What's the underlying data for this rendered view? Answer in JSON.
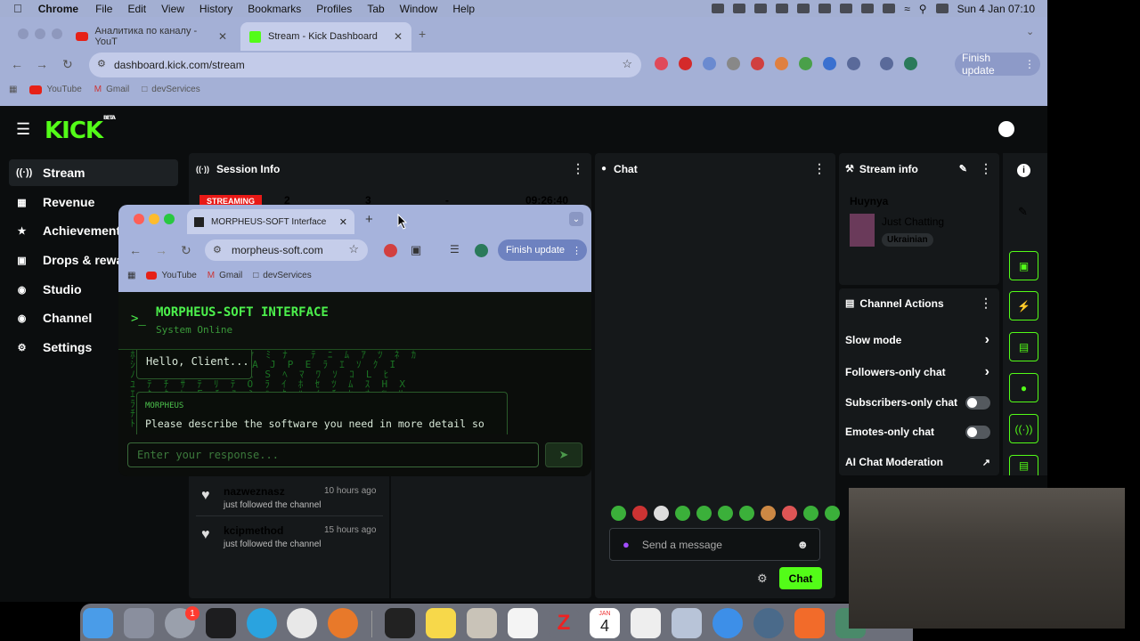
{
  "menubar": {
    "app": "Chrome",
    "items": [
      "File",
      "Edit",
      "View",
      "History",
      "Bookmarks",
      "Profiles",
      "Tab",
      "Window",
      "Help"
    ],
    "datetime": "Sun 4 Jan  07:10"
  },
  "browser": {
    "tabs": [
      {
        "label": "Аналитика по каналу - YouT",
        "icon": "youtube-icon"
      },
      {
        "label": "Stream - Kick Dashboard",
        "icon": "kick-icon"
      }
    ],
    "url": "dashboard.kick.com/stream",
    "finish_update": "Finish update",
    "bookmarks": [
      "YouTube",
      "Gmail",
      "devServices"
    ]
  },
  "kick": {
    "logo": "KICK",
    "beta": "BETA",
    "sidebar": [
      {
        "label": "Stream",
        "icon": "stream-icon"
      },
      {
        "label": "Revenue",
        "icon": "revenue-icon"
      },
      {
        "label": "Achievements",
        "icon": "trophy-icon"
      },
      {
        "label": "Drops & rewards",
        "icon": "drops-icon"
      },
      {
        "label": "Studio",
        "icon": "studio-icon"
      },
      {
        "label": "Channel",
        "icon": "channel-icon"
      },
      {
        "label": "Settings",
        "icon": "gear-icon"
      }
    ],
    "session": {
      "title": "Session Info",
      "status": "STREAMING",
      "stats": [
        "2",
        "3",
        "-",
        "09:26:40"
      ]
    },
    "feed": [
      {
        "user": "nazweznasz",
        "time": "10 hours ago",
        "action": "just followed the channel"
      },
      {
        "user": "kcipmethod",
        "time": "15 hours ago",
        "action": "just followed the channel"
      }
    ],
    "chat": {
      "title": "Chat",
      "placeholder": "Send a message",
      "send": "Chat"
    },
    "stream_info": {
      "title": "Stream info",
      "stream_title": "Huynya",
      "category": "Just Chatting",
      "tag": "Ukrainian"
    },
    "channel_actions": {
      "title": "Channel Actions",
      "items": [
        "Slow mode",
        "Followers-only chat",
        "Subscribers-only chat",
        "Emotes-only chat",
        "AI Chat Moderation"
      ]
    }
  },
  "popup": {
    "tab": "MORPHEUS-SOFT Interface",
    "url": "morpheus-soft.com",
    "finish_update": "Finish update",
    "bookmarks": [
      "YouTube",
      "Gmail",
      "devServices"
    ],
    "prompt": ">_",
    "title": "MORPHEUS-SOFT INTERFACE",
    "status": "System Online",
    "greeting": "Hello, Client...",
    "sender": "MORPHEUS",
    "message": "Please describe the software you need in more detail so",
    "input_placeholder": "Enter your response..."
  },
  "dock": {
    "settings_badge": "1",
    "calendar_month": "JAN",
    "calendar_day": "4"
  }
}
